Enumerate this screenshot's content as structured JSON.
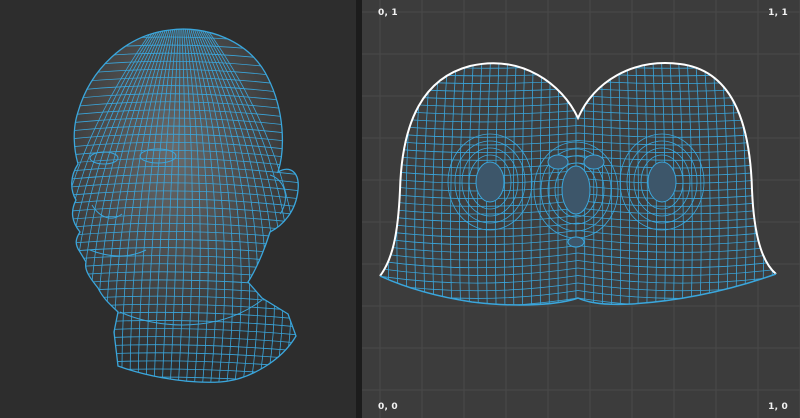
{
  "viewport_3d": {
    "icon": "wireframe-head-mesh"
  },
  "uv_editor": {
    "labels": {
      "top_left": "0, 1",
      "top_right": "1, 1",
      "bottom_left": "0, 0",
      "bottom_right": "1, 0"
    }
  },
  "colors": {
    "viewport_bg": "#2d2d2d",
    "uv_bg": "#3c3c3c",
    "grid_line": "#4a4a4a",
    "wire": "#3aa6dc",
    "boundary": "#ffffff",
    "divider": "#1c1c1c"
  }
}
